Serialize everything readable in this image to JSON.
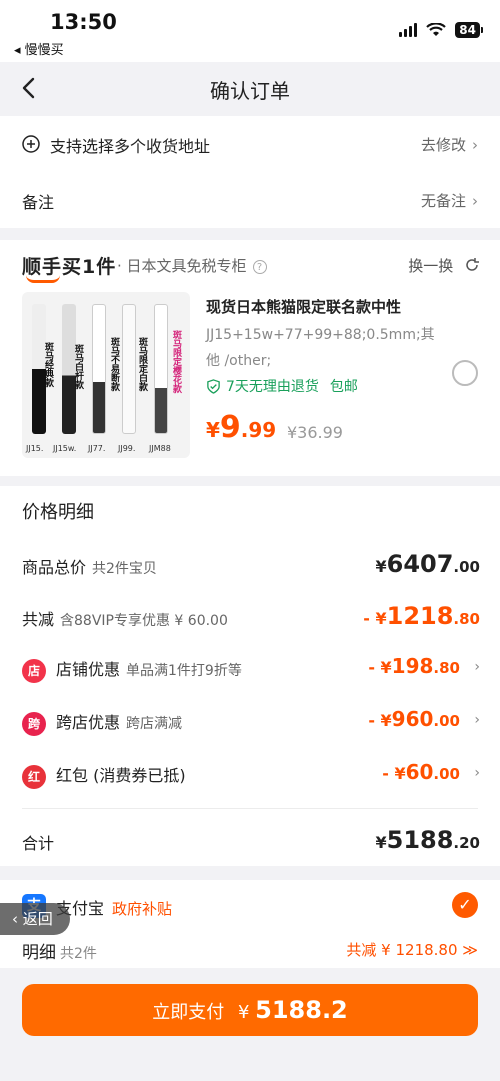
{
  "status_bar": {
    "time": "13:50",
    "back_app": "◂ 慢慢买",
    "battery": "84"
  },
  "nav": {
    "title": "确认订单"
  },
  "address": {
    "label": "支持选择多个收货地址",
    "action": "去修改"
  },
  "note": {
    "label": "备注",
    "value": "无备注"
  },
  "store": {
    "brand": "顺手买1件",
    "name": "· 日本文具免税专柜",
    "swap": "换一换"
  },
  "product": {
    "title": "现货日本熊猫限定联名款中性",
    "spec": "JJ15+15w+77+99+88;0.5mm;其他 /other;",
    "return_policy": "7天无理由退货",
    "shipping": "包邮",
    "price_currency": "¥",
    "price_int": "9",
    "price_dec": ".99",
    "original_price": "¥36.99",
    "image_labels": [
      "JJ15.",
      "JJ15w.",
      "JJ77.",
      "JJ99.",
      "JJM88"
    ],
    "image_texts": [
      "斑马经典款",
      "斑马白杆款",
      "斑马不易断款",
      "斑马限定白款",
      "斑马限定樱花款"
    ]
  },
  "price_detail": {
    "title": "价格明细",
    "total_label": "商品总价",
    "total_sub": "共2件宝贝",
    "total_cur": "¥",
    "total_int": "6407",
    "total_dec": ".00",
    "discount_label": "共减",
    "discount_sub": "含88VIP专享优惠 ¥ 60.00",
    "discount_prefix": "- ¥",
    "discount_int": "1218",
    "discount_dec": ".80",
    "items": [
      {
        "icon": "店",
        "label": "店铺优惠",
        "sub": "单品满1件打9折等",
        "prefix": "- ¥",
        "int": "198",
        "dec": ".80"
      },
      {
        "icon": "跨",
        "label": "跨店优惠",
        "sub": "跨店满减",
        "prefix": "- ¥",
        "int": "960",
        "dec": ".00"
      },
      {
        "icon": "红",
        "label": "红包 (消费券已抵)",
        "sub": "",
        "prefix": "- ¥",
        "int": "60",
        "dec": ".00"
      }
    ],
    "sum_label": "合计",
    "sum_cur": "¥",
    "sum_int": "5188",
    "sum_dec": ".20"
  },
  "payment": {
    "method": "支付宝",
    "subsidy": "政府补贴",
    "back_float": "返回",
    "detail_label": "明细",
    "detail_count": "共2件",
    "detail_saving": "共减 ¥ 1218.80 ≫"
  },
  "pay_button": {
    "label": "立即支付",
    "currency": "¥",
    "amount": "5188.2"
  },
  "colors": {
    "accent": "#ff5000",
    "button": "#ff6a00",
    "green": "#1aa05b",
    "alipay": "#1677ff"
  }
}
